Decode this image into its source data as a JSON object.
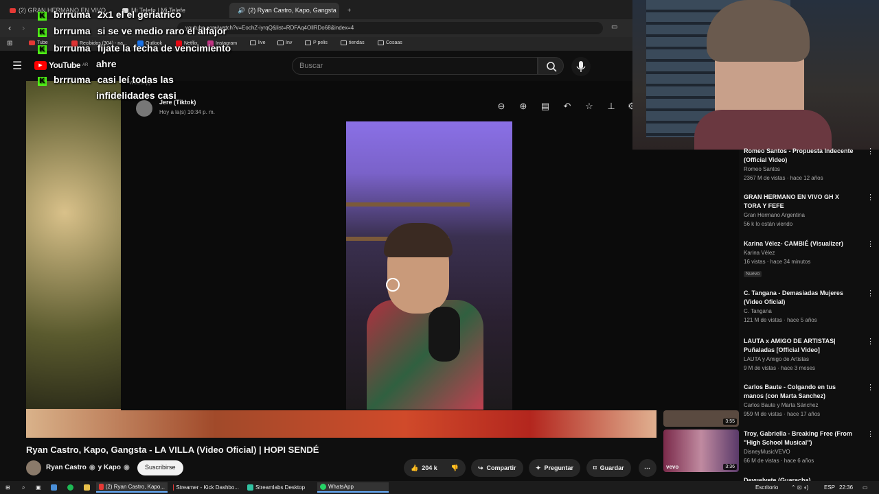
{
  "browser": {
    "tabs": [
      {
        "label": "(2) GRAN HERMANO EN VIVO"
      },
      {
        "label": "Mi Telefe | Mi Telefe"
      },
      {
        "label": "(2) Ryan Castro, Kapo, Gangsta"
      }
    ],
    "url": "youtube.com/watch?v=EochZ-iyrqQ&list=RDFAq4OllRDo68&index=4",
    "bookmarks": [
      "Tube",
      "Recibidos (304) - na...",
      "Outlook",
      "Netflix",
      "Instagram",
      "live",
      "Inv",
      "P pelis",
      "tiendas",
      "Cosaas"
    ]
  },
  "youtube": {
    "logo": "YouTube",
    "region": "AR",
    "search_placeholder": "Buscar"
  },
  "whatsapp_viewer": {
    "sender": "Jere (Tiktok)",
    "time": "Hoy a la(s) 10:34 p. m.",
    "app_label": "WhatsApp"
  },
  "chat": [
    {
      "user": "brrruma",
      "message": "2x1 el el geriatrico"
    },
    {
      "user": "brrruma",
      "message": "si se ve medio raro el alfajor"
    },
    {
      "user": "brrruma",
      "message": "fijate la fecha de vencimiento"
    },
    {
      "user": "",
      "message": "ahre"
    },
    {
      "user": "brrruma",
      "message": "casi leí todas las"
    },
    {
      "user": "",
      "message": "infidelidades casi"
    }
  ],
  "video": {
    "title": "Ryan Castro, Kapo, Gangsta - LA VILLA (Video Oficial) | HOPI SENDÉ",
    "channel": "Ryan Castro",
    "channel_suffix": "y Kapo",
    "subscribe": "Suscribirse",
    "likes": "204 k",
    "share": "Compartir",
    "ask": "Preguntar",
    "save": "Guardar"
  },
  "sidebar": [
    {
      "title": "Romeo Santos - Propuesta Indecente (Official Video)",
      "channel": "Romeo Santos",
      "meta": "2367 M de vistas · hace 12 años"
    },
    {
      "title": "GRAN HERMANO EN VIVO GH X TORA Y FEFE",
      "channel": "Gran Hermano Argentina",
      "meta": "56 k lo están viendo"
    },
    {
      "title": "Karina Vélez- CAMBIÉ (Visualizer)",
      "channel": "Karina Vélez",
      "meta": "16 vistas · hace 34 minutos",
      "badge": "Nuevo"
    },
    {
      "title": "C. Tangana - Demasiadas Mujeres (Video Oficial)",
      "channel": "C. Tangana",
      "meta": "121 M de vistas · hace 5 años"
    },
    {
      "title": "LAUTA x AMIGO DE ARTISTAS| Puñaladas [Official Video]",
      "channel": "LAUTA y Amigo de Artistas",
      "meta": "9 M de vistas · hace 3 meses"
    },
    {
      "title": "Carlos Baute - Colgando en tus manos (con Marta Sanchez)",
      "channel": "Carlos Baute y Marta Sánchez",
      "meta": "959 M de vistas · hace 17 años"
    },
    {
      "title": "Troy, Gabriella - Breaking Free (From \"High School Musical\")",
      "channel": "DisneyMusicVEVO",
      "meta": "66 M de vistas · hace 6 años"
    },
    {
      "title": "Devuelvete (Guaracha)",
      "channel": "",
      "meta": ""
    }
  ],
  "thumbs": [
    {
      "duration": "3:55"
    },
    {
      "duration": "3:36",
      "brand": "vevo"
    }
  ],
  "taskbar": {
    "items": [
      "(2) Ryan Castro, Kapo...",
      "Streamer - Kick Dashbo...",
      "Streamlabs Desktop",
      "WhatsApp"
    ],
    "desktop": "Escritorio",
    "lang": "ESP",
    "time": "22:36"
  }
}
